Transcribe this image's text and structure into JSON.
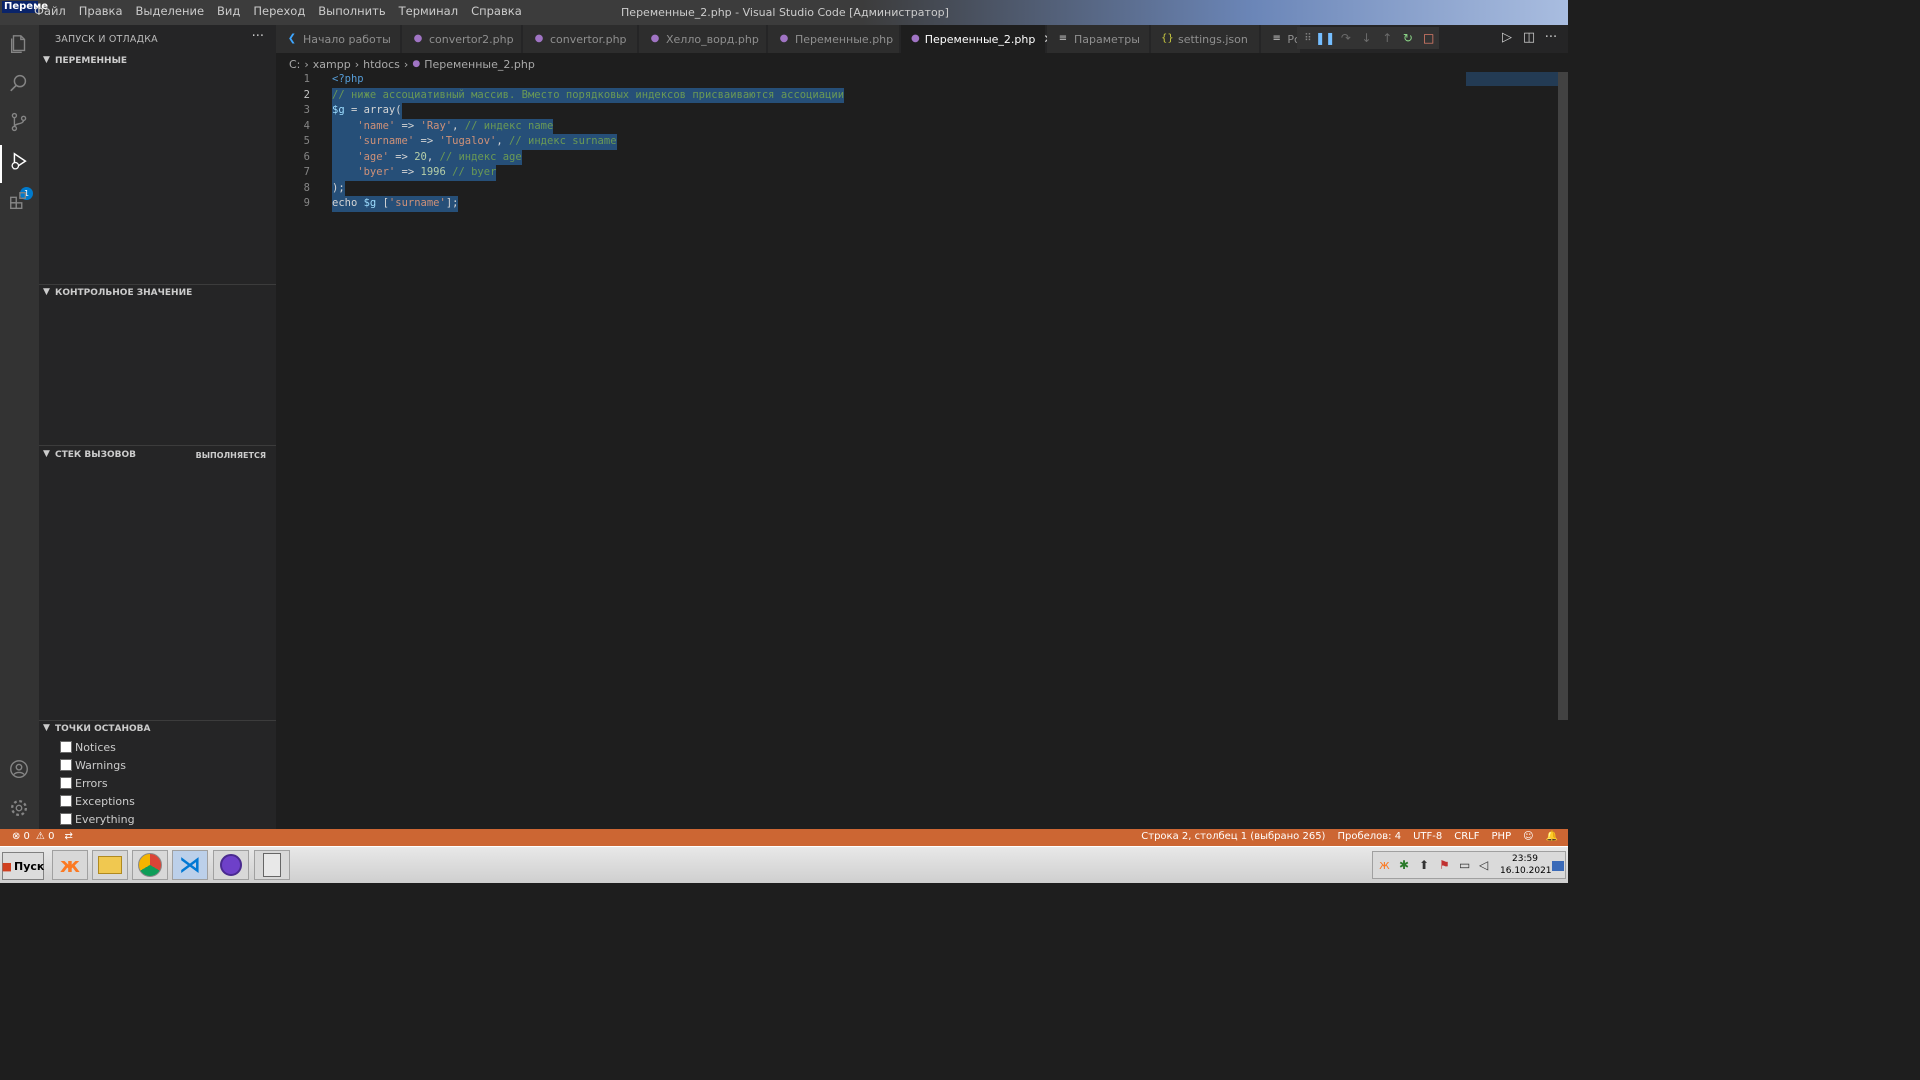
{
  "titlebar": {
    "app_icon_label": "Переме",
    "title": "Переменные_2.php - Visual Studio Code [Администратор]",
    "menu": [
      "Файл",
      "Правка",
      "Выделение",
      "Вид",
      "Переход",
      "Выполнить",
      "Терминал",
      "Справка"
    ]
  },
  "activity_bar": {
    "icons": [
      "files-icon",
      "search-icon",
      "source-control-icon",
      "run-debug-icon",
      "extensions-icon",
      "account-icon",
      "gear-icon"
    ],
    "debug_badge": "1"
  },
  "sidebar": {
    "title": "ЗАПУСК И ОТЛАДКА",
    "more": "···",
    "sections": {
      "variables": "ПЕРЕМЕННЫЕ",
      "watch": "КОНТРОЛЬНОЕ ЗНАЧЕНИЕ",
      "callstack": "СТЕК ВЫЗОВОВ",
      "callstack_status": "ВЫПОЛНЯЕТСЯ",
      "breakpoints": "ТОЧКИ ОСТАНОВА"
    },
    "breakpoints": [
      "Notices",
      "Warnings",
      "Errors",
      "Exceptions",
      "Everything"
    ]
  },
  "tabs": [
    {
      "label": "Начало работы",
      "icon": "vscode-icon"
    },
    {
      "label": "convertor2.php",
      "icon": "php-icon"
    },
    {
      "label": "convertor.php",
      "icon": "php-icon"
    },
    {
      "label": "Хелло_ворд.php",
      "icon": "php-icon"
    },
    {
      "label": "Переменные.php",
      "icon": "php-icon"
    },
    {
      "label": "Переменные_2.php",
      "icon": "php-icon",
      "active": true
    },
    {
      "label": "Параметры",
      "icon": "settings-icon"
    },
    {
      "label": "settings.json",
      "icon": "json-icon"
    },
    {
      "label": "Pc",
      "icon": "settings-icon"
    }
  ],
  "breadcrumb": [
    "C:",
    "xampp",
    "htdocs",
    "Переменные_2.php"
  ],
  "editor": {
    "line_numbers": [
      "1",
      "2",
      "3",
      "4",
      "5",
      "6",
      "7",
      "8",
      "9"
    ],
    "lines": {
      "l1": "<?php",
      "l2": "// ниже ассоциативный массив. Вместо порядковых индексов присваиваются ассоциации",
      "l3a": "$g",
      "l3b": " = ",
      "l3c": "array",
      "l3d": "(",
      "l4a": "    'name'",
      "l4b": " => ",
      "l4c": "'Ray'",
      "l4d": ", ",
      "l4e": "// индекс name",
      "l5a": "    'surname'",
      "l5b": " => ",
      "l5c": "'Tugalov'",
      "l5d": ", ",
      "l5e": "// индекс surname",
      "l6a": "    'age'",
      "l6b": " => ",
      "l6c": "20",
      "l6d": ", ",
      "l6e": "// индекс age",
      "l7a": "    'byer'",
      "l7b": " => ",
      "l7c": "1996",
      "l7d": " ",
      "l7e": "// byer",
      "l8": ");",
      "l9a": "echo ",
      "l9b": "$g",
      "l9c": " [",
      "l9d": "'surname'",
      "l9e": "];"
    }
  },
  "statusbar": {
    "errors": "⊗ 0",
    "warnings": "⚠ 0",
    "position": "Строка 2, столбец 1 (выбрано 265)",
    "spaces": "Пробелов: 4",
    "encoding": "UTF-8",
    "eol": "CRLF",
    "language": "PHP"
  },
  "taskbar": {
    "start": "Пуск",
    "apps": [
      "xampp-icon",
      "explorer-icon",
      "chrome-icon",
      "vscode-icon",
      "github-icon",
      "calculator-icon"
    ],
    "time": "23:59",
    "date": "16.10.2021"
  },
  "colors": {
    "accent": "#007acc",
    "statusbar": "#cc6633",
    "selection": "#264f78"
  }
}
